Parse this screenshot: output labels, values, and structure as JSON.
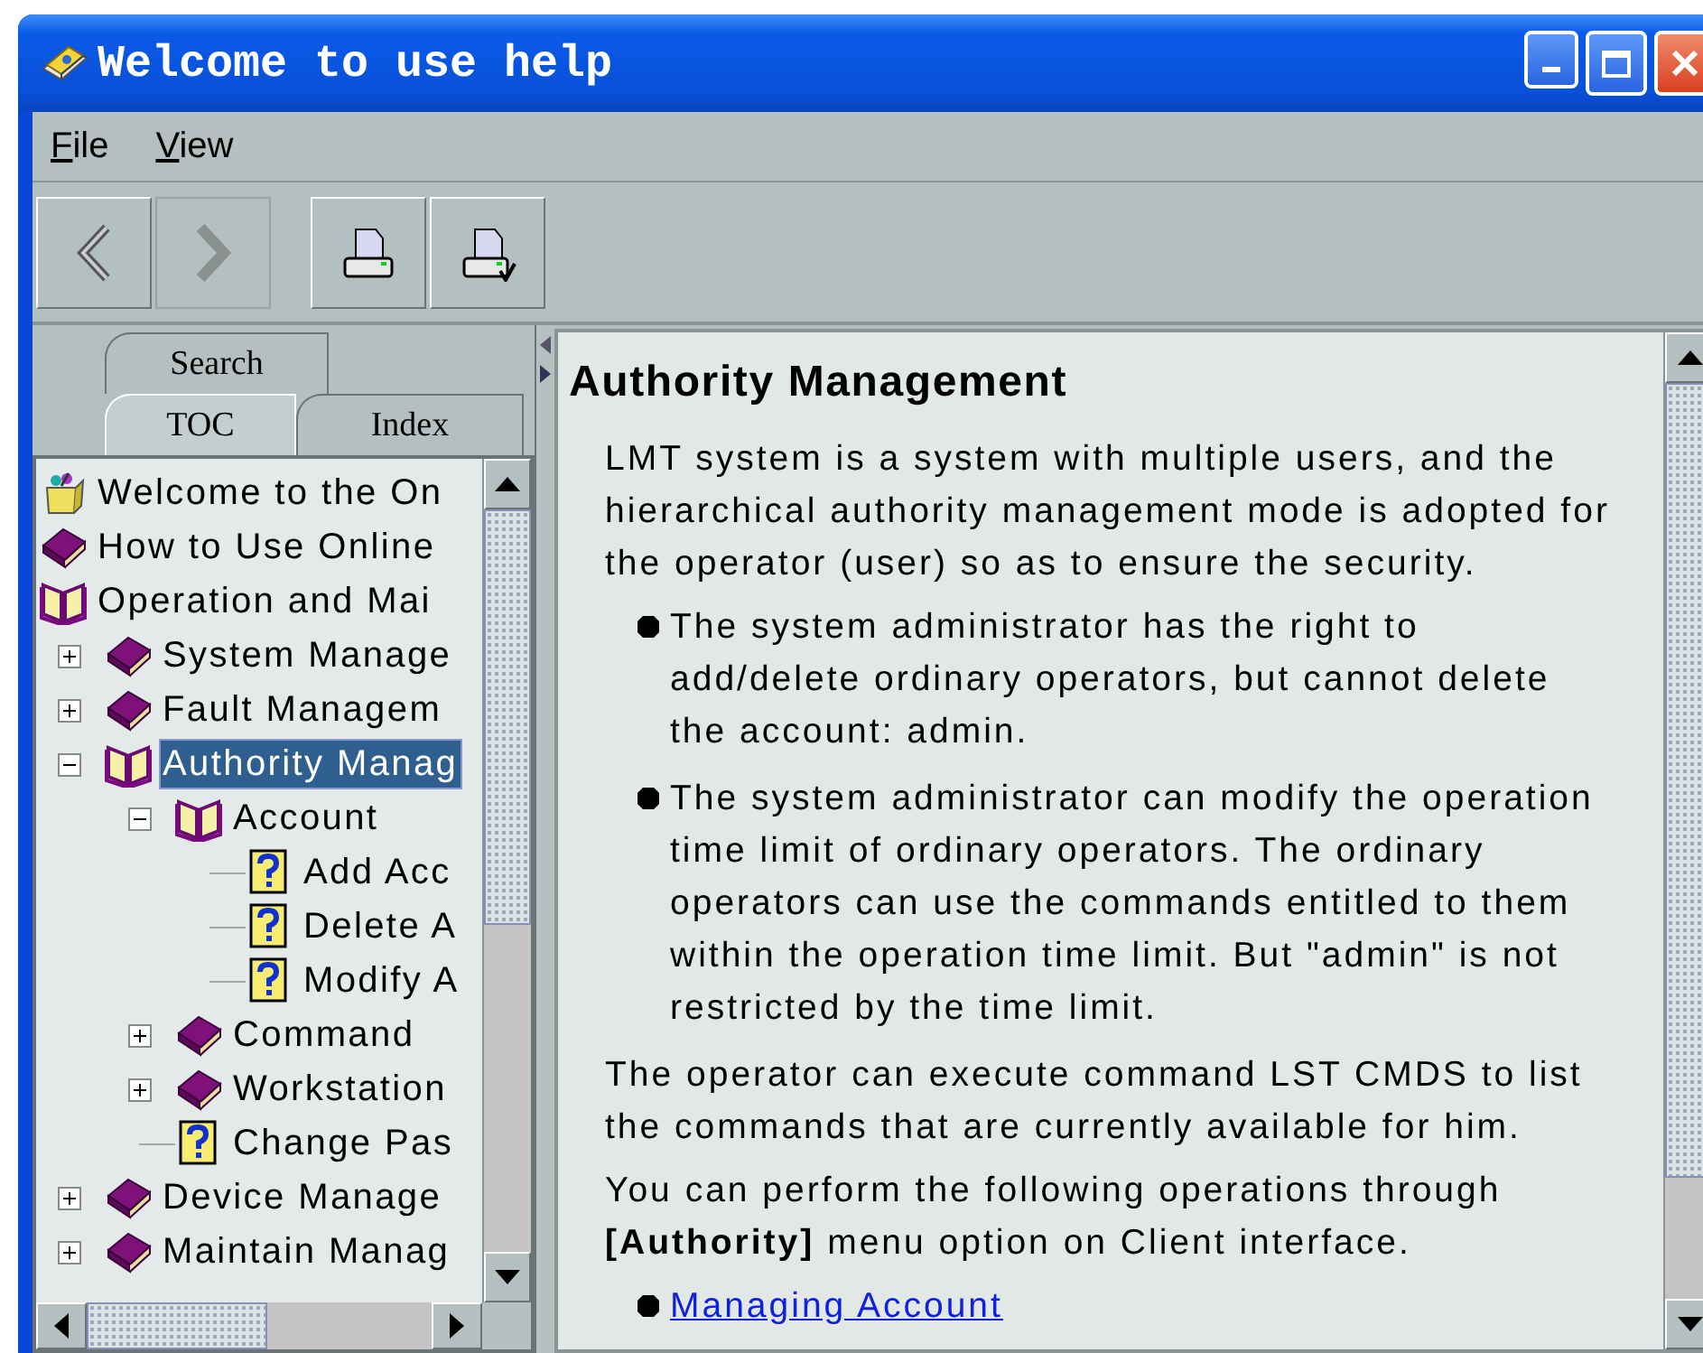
{
  "window": {
    "title": "Welcome to use help"
  },
  "menu": [
    "File",
    "View"
  ],
  "toolbar": [
    {
      "kind": "back",
      "disabled": false
    },
    {
      "kind": "forward",
      "disabled": true
    },
    {
      "kind": "print",
      "disabled": false
    },
    {
      "kind": "page-setup",
      "disabled": false
    }
  ],
  "tab_rows": [
    {
      "tabs": [
        {
          "label": "Search",
          "selected": false
        }
      ]
    },
    {
      "tabs": [
        {
          "label": "TOC",
          "selected": true
        },
        {
          "label": "Index",
          "selected": false
        }
      ]
    }
  ],
  "toc": [
    {
      "label": "Welcome to the On",
      "kind": "start",
      "selected": false
    },
    {
      "label": "How to Use Online",
      "kind": "book",
      "expanded": false,
      "selected": false
    },
    {
      "label": "Operation and Mai",
      "kind": "book",
      "expanded": true,
      "selected": false,
      "children": [
        {
          "label": "System Manage",
          "kind": "book",
          "expanded": false,
          "selected": false
        },
        {
          "label": "Fault Managem",
          "kind": "book",
          "expanded": false,
          "selected": false
        },
        {
          "label": "Authority Manag",
          "kind": "book",
          "expanded": true,
          "selected": true,
          "children": [
            {
              "label": "Account",
              "kind": "book",
              "expanded": true,
              "selected": false,
              "children": [
                {
                  "label": "Add Acc",
                  "kind": "topic",
                  "selected": false
                },
                {
                  "label": "Delete A",
                  "kind": "topic",
                  "selected": false
                },
                {
                  "label": "Modify A",
                  "kind": "topic",
                  "selected": false
                }
              ]
            },
            {
              "label": "Command",
              "kind": "book",
              "expanded": false,
              "selected": false
            },
            {
              "label": "Workstation",
              "kind": "book",
              "expanded": false,
              "selected": false
            },
            {
              "label": "Change Pas",
              "kind": "topic",
              "selected": false
            }
          ]
        },
        {
          "label": "Device Manage",
          "kind": "book",
          "expanded": false,
          "selected": false
        },
        {
          "label": "Maintain Manag",
          "kind": "book",
          "expanded": false,
          "selected": false
        }
      ]
    }
  ],
  "content": [
    {
      "kind": "heading",
      "text": "Authority Management"
    },
    {
      "kind": "paragraph",
      "text": "LMT system is a system with multiple users, and the hierarchical authority management mode is adopted for the operator (user) so as to ensure the security."
    },
    {
      "kind": "bullets",
      "items": [
        {
          "kind": "text",
          "text": "The system administrator has the right to add/delete ordinary operators, but cannot delete the account: admin."
        },
        {
          "kind": "text",
          "text": "The system administrator can modify the operation time limit of ordinary operators. The ordinary operators can use the commands entitled to them within the operation time limit. But \"admin\" is not restricted by the time limit."
        }
      ]
    },
    {
      "kind": "paragraph",
      "text": "The operator can execute command LST CMDS to list the commands that are currently available for him."
    },
    {
      "kind": "paragraph",
      "text": "You can perform the following operations through **[Authority]** menu option on Client interface."
    },
    {
      "kind": "bullets",
      "items": [
        {
          "kind": "link",
          "text": "Managing Account"
        }
      ]
    }
  ]
}
